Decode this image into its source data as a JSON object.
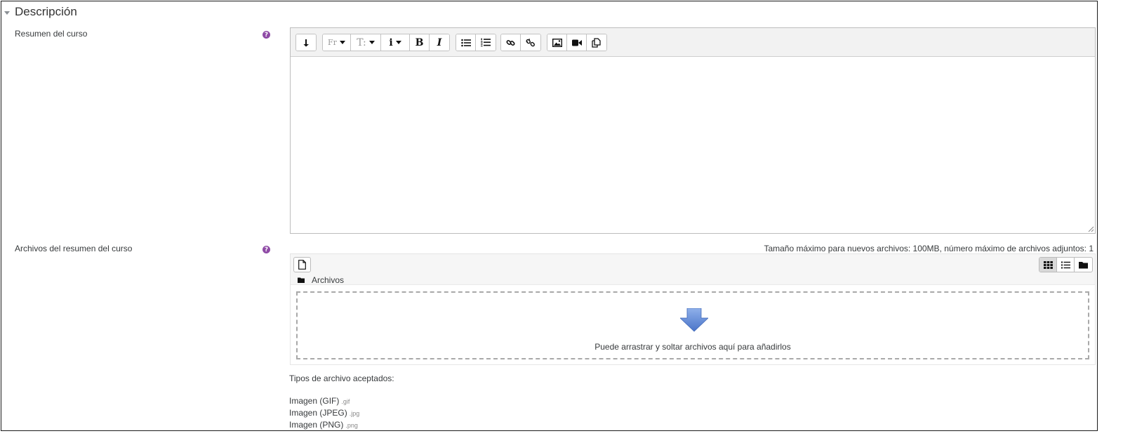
{
  "section": {
    "title": "Descripción"
  },
  "summary": {
    "label": "Resumen del curso",
    "help_icon": "question-circle-icon"
  },
  "toolbar": {
    "groups": [
      {
        "buttons": [
          "collapse-icon"
        ]
      },
      {
        "buttons": [
          "font-family-icon",
          "font-size-icon",
          "paragraph-style-icon",
          "bold-icon",
          "italic-icon"
        ]
      },
      {
        "buttons": [
          "unordered-list-icon",
          "ordered-list-icon"
        ]
      },
      {
        "buttons": [
          "link-icon",
          "unlink-icon"
        ]
      },
      {
        "buttons": [
          "image-icon",
          "media-icon",
          "manage-files-icon"
        ]
      }
    ],
    "font_label": "Fr",
    "size_label": "T:",
    "style_label": "i",
    "bold_label": "B",
    "italic_label": "I"
  },
  "files": {
    "label": "Archivos del resumen del curso",
    "max_info": "Tamaño máximo para nuevos archivos: 100MB, número máximo de archivos adjuntos: 1",
    "path": "Archivos",
    "drop_message": "Puede arrastrar y soltar archivos aquí para añadirlos",
    "active_view": "icons"
  },
  "accepted": {
    "heading": "Tipos de archivo aceptados:",
    "types": [
      {
        "name": "Imagen (GIF)",
        "ext": ".gif"
      },
      {
        "name": "Imagen (JPEG)",
        "ext": ".jpg"
      },
      {
        "name": "Imagen (PNG)",
        "ext": ".png"
      }
    ]
  },
  "colors": {
    "help": "#8f4ba6",
    "drop_arrow": "#5b86d6"
  }
}
